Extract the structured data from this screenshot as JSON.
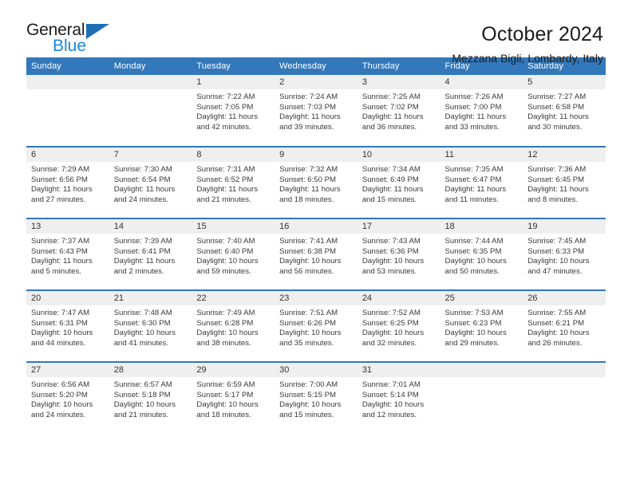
{
  "brand": {
    "name_part1": "General",
    "name_part2": "Blue",
    "triangle_icon": "triangle-icon",
    "accent_color": "#1b86d6"
  },
  "header": {
    "title": "October 2024",
    "subtitle": "Mezzana Bigli, Lombardy, Italy"
  },
  "colors": {
    "header_blue": "#3278ba",
    "daynum_gray": "#efefef",
    "text": "#3a3a3a"
  },
  "weekday_headers": [
    "Sunday",
    "Monday",
    "Tuesday",
    "Wednesday",
    "Thursday",
    "Friday",
    "Saturday"
  ],
  "labels": {
    "sunrise": "Sunrise:",
    "sunset": "Sunset:",
    "daylight": "Daylight:"
  },
  "weeks": [
    [
      {
        "day": "",
        "blank": true
      },
      {
        "day": "",
        "blank": true
      },
      {
        "day": "1",
        "sunrise": "Sunrise: 7:22 AM",
        "sunset": "Sunset: 7:05 PM",
        "daylight": "Daylight: 11 hours and 42 minutes."
      },
      {
        "day": "2",
        "sunrise": "Sunrise: 7:24 AM",
        "sunset": "Sunset: 7:03 PM",
        "daylight": "Daylight: 11 hours and 39 minutes."
      },
      {
        "day": "3",
        "sunrise": "Sunrise: 7:25 AM",
        "sunset": "Sunset: 7:02 PM",
        "daylight": "Daylight: 11 hours and 36 minutes."
      },
      {
        "day": "4",
        "sunrise": "Sunrise: 7:26 AM",
        "sunset": "Sunset: 7:00 PM",
        "daylight": "Daylight: 11 hours and 33 minutes."
      },
      {
        "day": "5",
        "sunrise": "Sunrise: 7:27 AM",
        "sunset": "Sunset: 6:58 PM",
        "daylight": "Daylight: 11 hours and 30 minutes."
      }
    ],
    [
      {
        "day": "6",
        "sunrise": "Sunrise: 7:29 AM",
        "sunset": "Sunset: 6:56 PM",
        "daylight": "Daylight: 11 hours and 27 minutes."
      },
      {
        "day": "7",
        "sunrise": "Sunrise: 7:30 AM",
        "sunset": "Sunset: 6:54 PM",
        "daylight": "Daylight: 11 hours and 24 minutes."
      },
      {
        "day": "8",
        "sunrise": "Sunrise: 7:31 AM",
        "sunset": "Sunset: 6:52 PM",
        "daylight": "Daylight: 11 hours and 21 minutes."
      },
      {
        "day": "9",
        "sunrise": "Sunrise: 7:32 AM",
        "sunset": "Sunset: 6:50 PM",
        "daylight": "Daylight: 11 hours and 18 minutes."
      },
      {
        "day": "10",
        "sunrise": "Sunrise: 7:34 AM",
        "sunset": "Sunset: 6:49 PM",
        "daylight": "Daylight: 11 hours and 15 minutes."
      },
      {
        "day": "11",
        "sunrise": "Sunrise: 7:35 AM",
        "sunset": "Sunset: 6:47 PM",
        "daylight": "Daylight: 11 hours and 11 minutes."
      },
      {
        "day": "12",
        "sunrise": "Sunrise: 7:36 AM",
        "sunset": "Sunset: 6:45 PM",
        "daylight": "Daylight: 11 hours and 8 minutes."
      }
    ],
    [
      {
        "day": "13",
        "sunrise": "Sunrise: 7:37 AM",
        "sunset": "Sunset: 6:43 PM",
        "daylight": "Daylight: 11 hours and 5 minutes."
      },
      {
        "day": "14",
        "sunrise": "Sunrise: 7:39 AM",
        "sunset": "Sunset: 6:41 PM",
        "daylight": "Daylight: 11 hours and 2 minutes."
      },
      {
        "day": "15",
        "sunrise": "Sunrise: 7:40 AM",
        "sunset": "Sunset: 6:40 PM",
        "daylight": "Daylight: 10 hours and 59 minutes."
      },
      {
        "day": "16",
        "sunrise": "Sunrise: 7:41 AM",
        "sunset": "Sunset: 6:38 PM",
        "daylight": "Daylight: 10 hours and 56 minutes."
      },
      {
        "day": "17",
        "sunrise": "Sunrise: 7:43 AM",
        "sunset": "Sunset: 6:36 PM",
        "daylight": "Daylight: 10 hours and 53 minutes."
      },
      {
        "day": "18",
        "sunrise": "Sunrise: 7:44 AM",
        "sunset": "Sunset: 6:35 PM",
        "daylight": "Daylight: 10 hours and 50 minutes."
      },
      {
        "day": "19",
        "sunrise": "Sunrise: 7:45 AM",
        "sunset": "Sunset: 6:33 PM",
        "daylight": "Daylight: 10 hours and 47 minutes."
      }
    ],
    [
      {
        "day": "20",
        "sunrise": "Sunrise: 7:47 AM",
        "sunset": "Sunset: 6:31 PM",
        "daylight": "Daylight: 10 hours and 44 minutes."
      },
      {
        "day": "21",
        "sunrise": "Sunrise: 7:48 AM",
        "sunset": "Sunset: 6:30 PM",
        "daylight": "Daylight: 10 hours and 41 minutes."
      },
      {
        "day": "22",
        "sunrise": "Sunrise: 7:49 AM",
        "sunset": "Sunset: 6:28 PM",
        "daylight": "Daylight: 10 hours and 38 minutes."
      },
      {
        "day": "23",
        "sunrise": "Sunrise: 7:51 AM",
        "sunset": "Sunset: 6:26 PM",
        "daylight": "Daylight: 10 hours and 35 minutes."
      },
      {
        "day": "24",
        "sunrise": "Sunrise: 7:52 AM",
        "sunset": "Sunset: 6:25 PM",
        "daylight": "Daylight: 10 hours and 32 minutes."
      },
      {
        "day": "25",
        "sunrise": "Sunrise: 7:53 AM",
        "sunset": "Sunset: 6:23 PM",
        "daylight": "Daylight: 10 hours and 29 minutes."
      },
      {
        "day": "26",
        "sunrise": "Sunrise: 7:55 AM",
        "sunset": "Sunset: 6:21 PM",
        "daylight": "Daylight: 10 hours and 26 minutes."
      }
    ],
    [
      {
        "day": "27",
        "sunrise": "Sunrise: 6:56 AM",
        "sunset": "Sunset: 5:20 PM",
        "daylight": "Daylight: 10 hours and 24 minutes."
      },
      {
        "day": "28",
        "sunrise": "Sunrise: 6:57 AM",
        "sunset": "Sunset: 5:18 PM",
        "daylight": "Daylight: 10 hours and 21 minutes."
      },
      {
        "day": "29",
        "sunrise": "Sunrise: 6:59 AM",
        "sunset": "Sunset: 5:17 PM",
        "daylight": "Daylight: 10 hours and 18 minutes."
      },
      {
        "day": "30",
        "sunrise": "Sunrise: 7:00 AM",
        "sunset": "Sunset: 5:15 PM",
        "daylight": "Daylight: 10 hours and 15 minutes."
      },
      {
        "day": "31",
        "sunrise": "Sunrise: 7:01 AM",
        "sunset": "Sunset: 5:14 PM",
        "daylight": "Daylight: 10 hours and 12 minutes."
      },
      {
        "day": "",
        "blank": true
      },
      {
        "day": "",
        "blank": true
      }
    ]
  ]
}
